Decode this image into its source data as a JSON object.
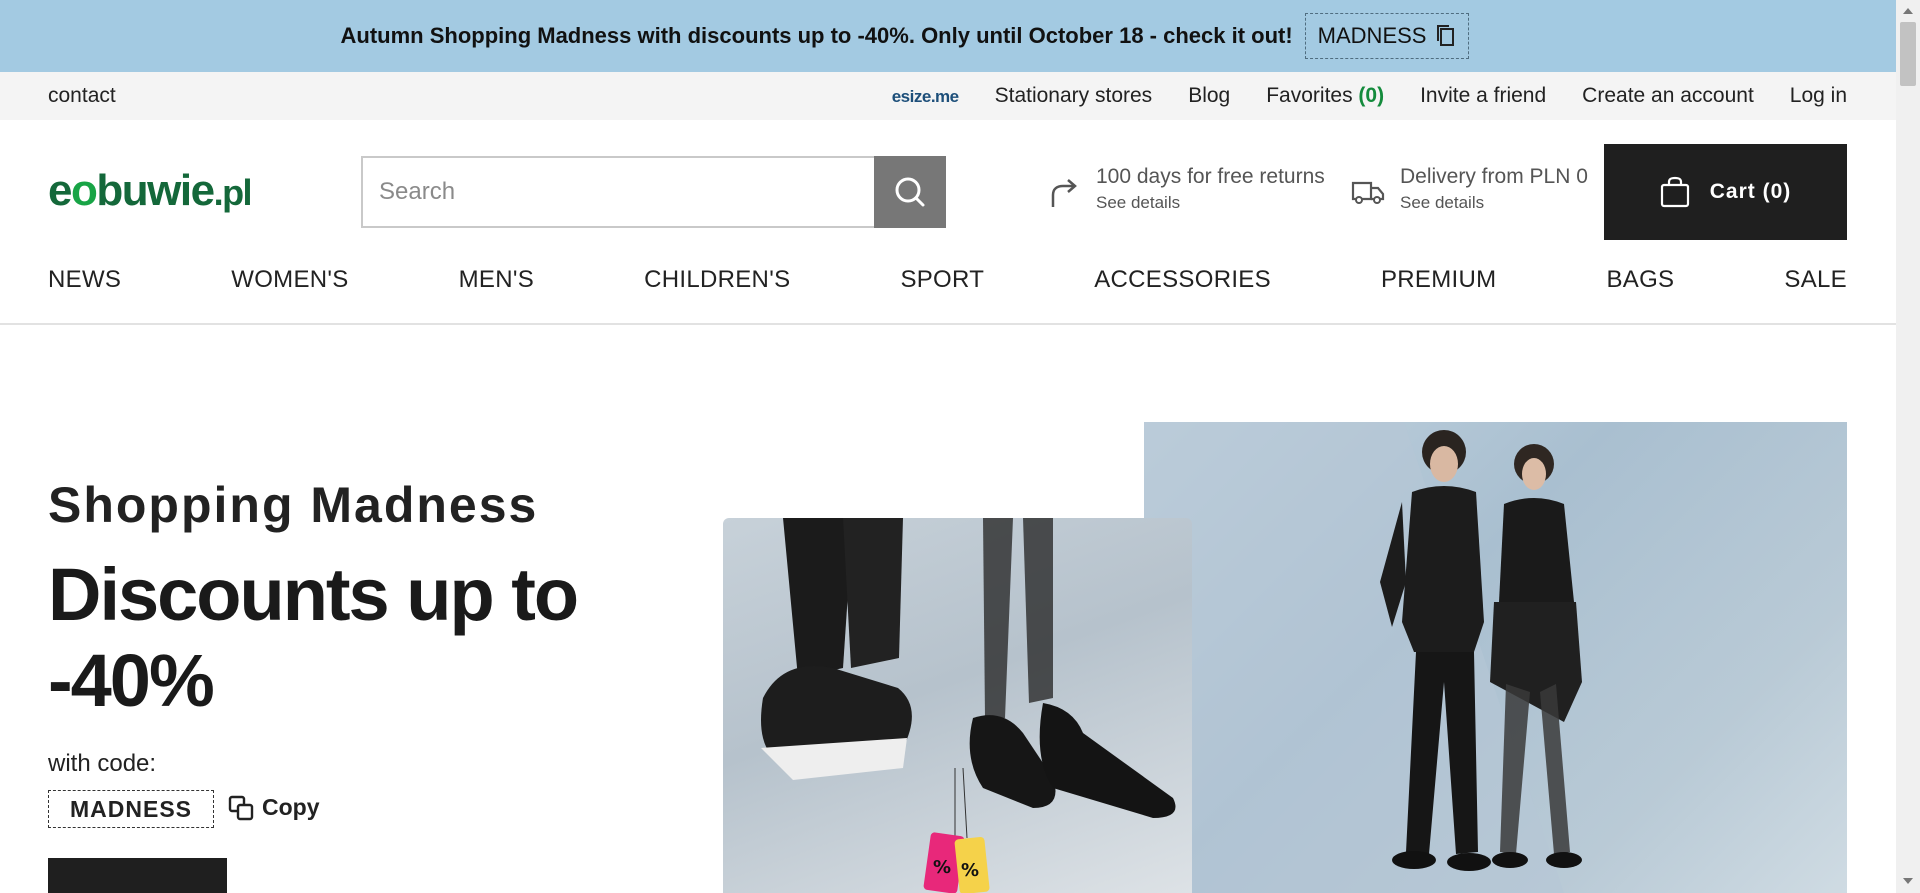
{
  "promo": {
    "text": "Autumn Shopping Madness with discounts up to -40%. Only until October 18 - check it out!",
    "code": "MADNESS",
    "copy_icon": "copy-icon"
  },
  "utility": {
    "contact": "contact",
    "esize": "esize",
    "esize_suffix": ".me",
    "stores": "Stationary stores",
    "blog": "Blog",
    "favorites": "Favorites",
    "favorites_count": "(0)",
    "invite": "Invite a friend",
    "create_account": "Create an account",
    "login": "Log in"
  },
  "header": {
    "logo_e": "e",
    "logo_o": "o",
    "logo_rest": "buwie",
    "logo_pl": ".pl",
    "search_placeholder": "Search",
    "returns_title": "100 days for free returns",
    "returns_link": "See details",
    "delivery_title": "Delivery from PLN 0",
    "delivery_link": "See details",
    "cart_label": "Cart (0)"
  },
  "nav": [
    "NEWS",
    "WOMEN'S",
    "MEN'S",
    "CHILDREN'S",
    "SPORT",
    "ACCESSORIES",
    "PREMIUM",
    "BAGS",
    "SALE"
  ],
  "hero": {
    "subtitle": "Shopping Madness",
    "title": "Discounts up to -40%",
    "code_label": "with code:",
    "code": "MADNESS",
    "copy_label": "Copy"
  },
  "colors": {
    "promo_bg": "#a3cae2",
    "brand_green": "#14683a",
    "favorites_green": "#148b3c",
    "cart_bg": "#1f1f1f"
  }
}
